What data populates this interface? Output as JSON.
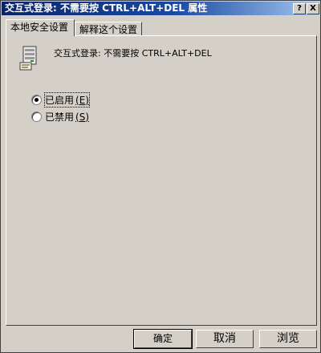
{
  "window": {
    "title": "交互式登录: 不需要按 CTRL+ALT+DEL 属性",
    "help_button": "?",
    "close_button": "X"
  },
  "tabs": [
    {
      "label": "本地安全设置",
      "active": true
    },
    {
      "label": "解释这个设置",
      "active": false
    }
  ],
  "policy": {
    "icon": "policy-server-icon",
    "name": "交互式登录: 不需要按 CTRL+ALT+DEL"
  },
  "options": [
    {
      "label": "已启用",
      "accel": "(E)",
      "checked": true
    },
    {
      "label": "已禁用",
      "accel": "(S)",
      "checked": false
    }
  ],
  "buttons": {
    "ok": "确定",
    "cancel": "取消",
    "browse": "浏览"
  }
}
